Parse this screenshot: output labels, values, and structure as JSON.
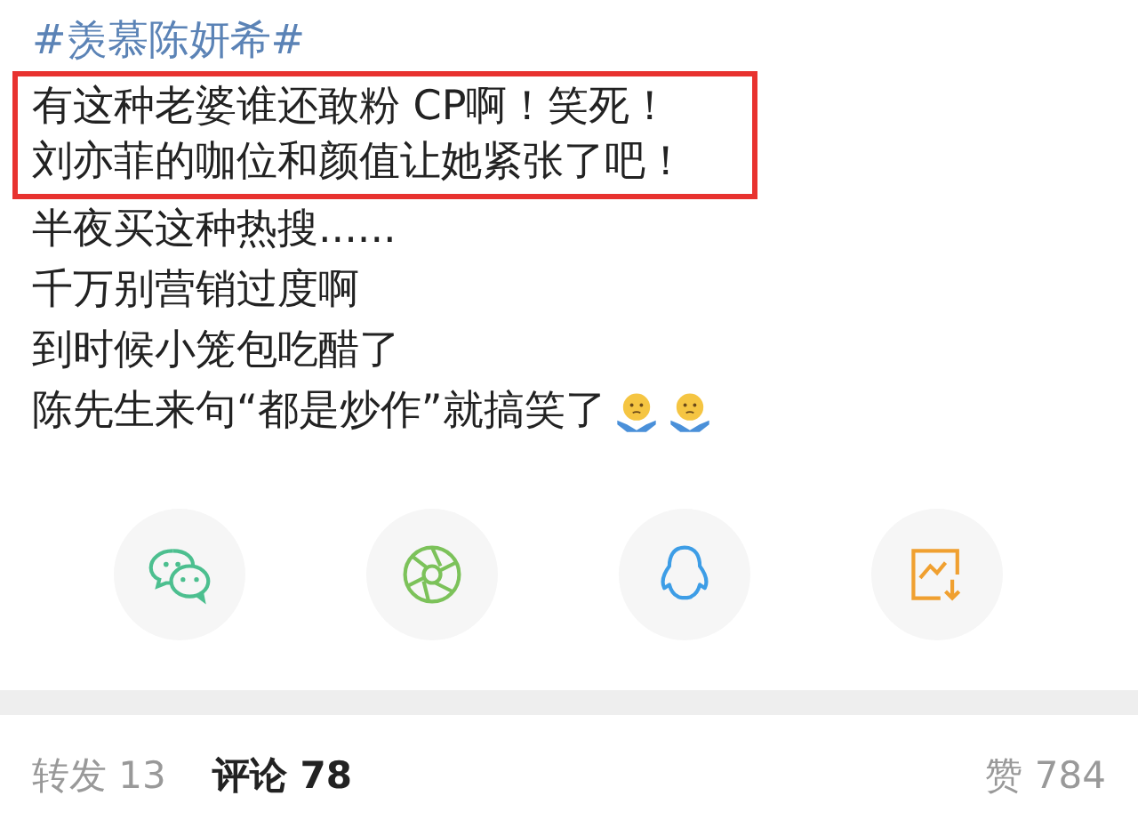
{
  "post": {
    "hashtag": "#羡慕陈妍希#",
    "highlighted_lines": [
      "有这种老婆谁还敢粉 CP啊！笑死！",
      "刘亦菲的咖位和颜值让她紧张了吧！"
    ],
    "lines": [
      "半夜买这种热搜......",
      "千万别营销过度啊",
      "到时候小笼包吃醋了",
      "陈先生来句“都是炒作”就搞笑了"
    ]
  },
  "share_buttons": [
    {
      "kind": "wechat"
    },
    {
      "kind": "moments"
    },
    {
      "kind": "qq"
    },
    {
      "kind": "save-image"
    }
  ],
  "tabs": [
    {
      "label": "转发 13",
      "selected": false
    },
    {
      "label": "评论 78",
      "selected": true
    },
    {
      "label": "赞 784",
      "selected": false
    }
  ]
}
